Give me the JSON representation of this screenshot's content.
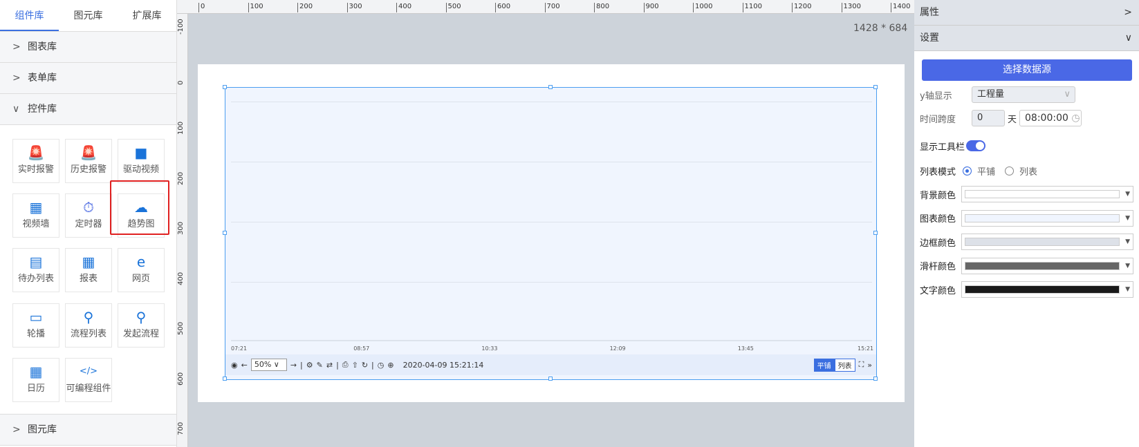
{
  "left_tabs": [
    "组件库",
    "图元库",
    "扩展库"
  ],
  "sections": {
    "chart": "图表库",
    "form": "表单库",
    "control": "控件库",
    "element": "图元库"
  },
  "widgets": [
    {
      "label": "实时报警",
      "icon": "alarm-icon",
      "color": "#f06010",
      "glyph": "🚨"
    },
    {
      "label": "历史报警",
      "icon": "history-alarm-icon",
      "color": "#f06010",
      "glyph": "🚨"
    },
    {
      "label": "驱动视频",
      "icon": "video-camera-icon",
      "color": "#1a73d9",
      "glyph": "■"
    },
    {
      "label": "视频墙",
      "icon": "video-wall-icon",
      "color": "#1a73d9",
      "glyph": "▦"
    },
    {
      "label": "定时器",
      "icon": "timer-icon",
      "color": "#4060e0",
      "glyph": "⏱"
    },
    {
      "label": "趋势图",
      "icon": "trend-chart-icon",
      "color": "#1a73d9",
      "glyph": "☁"
    },
    {
      "label": "待办列表",
      "icon": "todo-list-icon",
      "color": "#1a73d9",
      "glyph": "▤"
    },
    {
      "label": "报表",
      "icon": "report-table-icon",
      "color": "#1a73d9",
      "glyph": "▦"
    },
    {
      "label": "网页",
      "icon": "web-page-icon",
      "color": "#1a73d9",
      "glyph": "e"
    },
    {
      "label": "轮播",
      "icon": "carousel-icon",
      "color": "#1a73d9",
      "glyph": "▭"
    },
    {
      "label": "流程列表",
      "icon": "process-list-icon",
      "color": "#1a73d9",
      "glyph": "⚲"
    },
    {
      "label": "发起流程",
      "icon": "start-process-icon",
      "color": "#1a73d9",
      "glyph": "⚲"
    },
    {
      "label": "日历",
      "icon": "calendar-icon",
      "color": "#1a73d9",
      "glyph": "▦"
    },
    {
      "label": "可编程组件",
      "icon": "code-icon",
      "color": "#1a73d9",
      "glyph": "</>"
    }
  ],
  "ruler_top": [
    "0",
    "100",
    "200",
    "300",
    "400",
    "500",
    "600",
    "700",
    "800",
    "900",
    "1000",
    "1100",
    "1200",
    "1300",
    "1400"
  ],
  "ruler_left": [
    "-100",
    "0",
    "100",
    "200",
    "300",
    "400",
    "500",
    "600",
    "700"
  ],
  "canvas_size": "1428 * 684",
  "trend": {
    "x_ticks": [
      "07:21",
      "08:57",
      "10:33",
      "12:09",
      "13:45",
      "15:21"
    ],
    "zoom": "50%",
    "datetime": "2020-04-09 15:21:14",
    "mode_tile": "平铺",
    "mode_list": "列表"
  },
  "panel": {
    "properties": "属性",
    "settings": "设置",
    "select_source": "选择数据源",
    "y_axis_label": "y轴显示",
    "y_axis_value": "工程量",
    "span_label": "时间跨度",
    "span_days": "0",
    "day_unit": "天",
    "span_time": "08:00:00",
    "toolbar_label": "显示工具栏",
    "toolbar_on": true,
    "list_mode_label": "列表模式",
    "opt_tile": "平铺",
    "opt_list": "列表",
    "colors": [
      {
        "label": "背景颜色",
        "value": "#ffffff"
      },
      {
        "label": "图表颜色",
        "value": "#f0f5fe"
      },
      {
        "label": "边框颜色",
        "value": "#dde1e8"
      },
      {
        "label": "滑杆颜色",
        "value": "#666666"
      },
      {
        "label": "文字颜色",
        "value": "#1a1a1a"
      }
    ]
  }
}
